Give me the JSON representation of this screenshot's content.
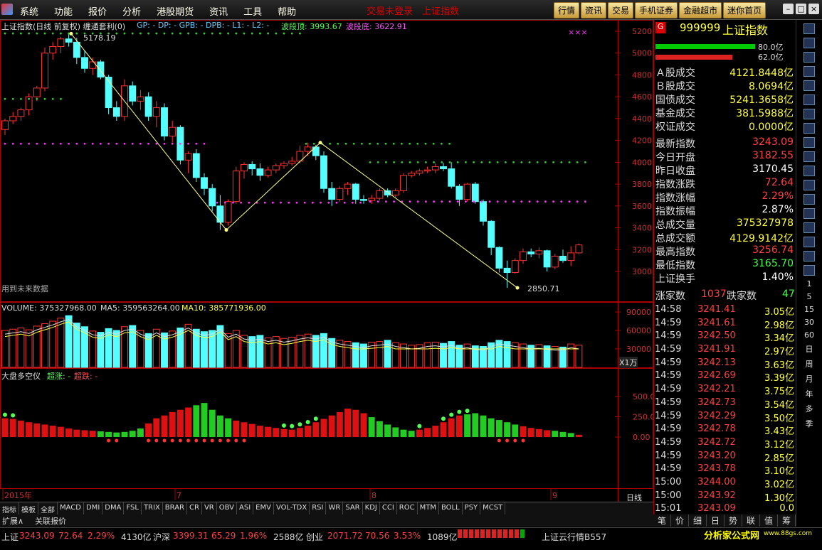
{
  "menu": [
    "系统",
    "功能",
    "报价",
    "分析",
    "港股期货",
    "资讯",
    "工具",
    "帮助"
  ],
  "window_title": "交易未登录　上证指数",
  "tabs": [
    "行情",
    "资讯",
    "交易",
    "手机证券",
    "金融超市",
    "迷你首页"
  ],
  "chart_label": "上证指数(日线 前复权) 缠通套利(0)",
  "indicators": "GP: -  DP: -  GPB: -  DPB: -  L1: -  L2: -",
  "wave_high_label": "波段顶: 3993.67",
  "wave_low_label": "波段底: 3622.91",
  "future_label": "用到未来数据",
  "high_mark": "5178.19",
  "low_mark": "2850.71",
  "price_axis": [
    "5200",
    "5000",
    "4800",
    "4600",
    "4400",
    "4200",
    "4000",
    "3800",
    "3600",
    "3400",
    "3200",
    "3000"
  ],
  "vol_label": "VOLUME: 375327968.00",
  "ma5_label": "MA5: 359563264.00",
  "ma10_label": "MA10: 385771936.00",
  "vol_axis": [
    "90000",
    "60000",
    "30000"
  ],
  "vol_unit": "X1万",
  "osc_title": "大盘多空仪",
  "osc_up": "超涨: -",
  "osc_down": "超跌: -",
  "osc_axis": [
    "500.0",
    "250.0",
    "0.00"
  ],
  "time_axis": [
    "2015年",
    "7",
    "8",
    "9"
  ],
  "period": "日线",
  "controls": [
    "+",
    "-",
    "0"
  ],
  "indicator_tabs": [
    "指标",
    "模板",
    "全部",
    "MACD",
    "DMI",
    "DMA",
    "FSL",
    "TRIX",
    "BRAR",
    "CR",
    "VR",
    "OBV",
    "ASI",
    "EMV",
    "VOL-TDX",
    "RSI",
    "WR",
    "SAR",
    "KDJ",
    "CCI",
    "ROC",
    "MTM",
    "BOLL",
    "PSY",
    "MCST"
  ],
  "extra_tabs": [
    "扩展∧",
    "关联报价"
  ],
  "stock": {
    "code": "999999",
    "name": "上证指数",
    "badge": "G",
    "bar1": "80.0亿",
    "bar2": "62.0亿"
  },
  "summary": [
    {
      "k": "Ａ股成交",
      "v": "4121.8448亿"
    },
    {
      "k": "Ｂ股成交",
      "v": "8.0694亿"
    },
    {
      "k": "国债成交",
      "v": "5241.3658亿"
    },
    {
      "k": "基金成交",
      "v": "381.5988亿"
    },
    {
      "k": "权证成交",
      "v": "0.0000亿"
    }
  ],
  "quote": [
    {
      "k": "最新指数",
      "v": "3243.09",
      "c": "#ff4040"
    },
    {
      "k": "今日开盘",
      "v": "3182.55",
      "c": "#ff4040"
    },
    {
      "k": "昨日收盘",
      "v": "3170.45",
      "c": "#ffffff"
    },
    {
      "k": "指数涨跌",
      "v": "72.64",
      "c": "#ff4040"
    },
    {
      "k": "指数涨幅",
      "v": "2.29%",
      "c": "#ff4040"
    },
    {
      "k": "指数振幅",
      "v": "2.87%",
      "c": "#ffffff"
    },
    {
      "k": "总成交量",
      "v": "375327978",
      "c": "#ffff40"
    },
    {
      "k": "总成交额",
      "v": "4129.9142亿",
      "c": "#ffff40"
    },
    {
      "k": "最高指数",
      "v": "3256.74",
      "c": "#ff4040"
    },
    {
      "k": "最低指数",
      "v": "3165.70",
      "c": "#40ff40"
    },
    {
      "k": "上证换手",
      "v": "1.40%",
      "c": "#ffffff"
    }
  ],
  "updown": {
    "up_label": "涨家数",
    "up": "1037",
    "down_label": "跌家数",
    "down": "47"
  },
  "ticks": [
    {
      "t": "14:58",
      "p": "3241.41",
      "a": "3.05亿"
    },
    {
      "t": "14:59",
      "p": "3241.61",
      "a": "2.98亿"
    },
    {
      "t": "14:59",
      "p": "3242.50",
      "a": "3.34亿"
    },
    {
      "t": "14:59",
      "p": "3241.91",
      "a": "2.97亿"
    },
    {
      "t": "14:59",
      "p": "3242.13",
      "a": "3.63亿"
    },
    {
      "t": "14:59",
      "p": "3242.69",
      "a": "3.39亿"
    },
    {
      "t": "14:59",
      "p": "3242.21",
      "a": "3.75亿"
    },
    {
      "t": "14:59",
      "p": "3242.73",
      "a": "3.54亿"
    },
    {
      "t": "14:59",
      "p": "3242.29",
      "a": "3.50亿"
    },
    {
      "t": "14:59",
      "p": "3242.78",
      "a": "3.43亿"
    },
    {
      "t": "14:59",
      "p": "3242.72",
      "a": "3.12亿"
    },
    {
      "t": "14:59",
      "p": "3243.20",
      "a": "2.85亿"
    },
    {
      "t": "14:59",
      "p": "3243.78",
      "a": "3.10亿"
    },
    {
      "t": "15:00",
      "p": "3244.00",
      "a": "3.02亿"
    },
    {
      "t": "15:00",
      "p": "3243.92",
      "a": "1.30亿"
    },
    {
      "t": "15:01",
      "p": "3243.09",
      "a": "0.0"
    }
  ],
  "right_tabs": [
    "笔",
    "价",
    "细",
    "日",
    "势",
    "联",
    "值",
    "筹"
  ],
  "right_tools": [
    "1",
    "5",
    "15",
    "30",
    "60",
    "日",
    "周",
    "月",
    "年",
    "多",
    "季"
  ],
  "status": {
    "sh_label": "上证",
    "sh": "3243.09",
    "sh_chg": "72.64",
    "sh_pct": "2.29%",
    "sh_amt": "4130亿",
    "hs_label": "沪深",
    "hs": "3399.31",
    "hs_chg": "65.29",
    "hs_pct": "1.96%",
    "hs_amt": "2588亿",
    "cy_label": "创业",
    "cy": "2071.72",
    "cy_chg": "70.56",
    "cy_pct": "3.53%",
    "cy_amt": "1089亿",
    "cloud": "上证云行情B557",
    "brand": "分析家公式网",
    "site": "www.88gs.com"
  }
}
